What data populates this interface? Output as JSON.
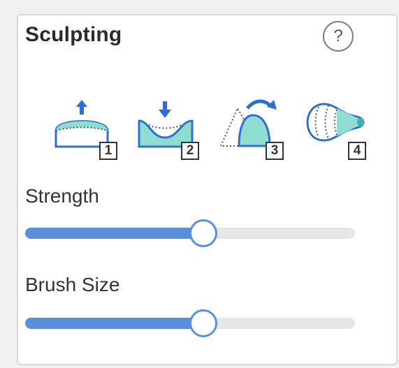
{
  "panel": {
    "title": "Sculpting",
    "help_label": "?"
  },
  "tools": [
    {
      "name": "raise",
      "key": "1",
      "icon": "raise-brush-icon"
    },
    {
      "name": "lower",
      "key": "2",
      "icon": "lower-brush-icon"
    },
    {
      "name": "smooth",
      "key": "3",
      "icon": "smooth-brush-icon"
    },
    {
      "name": "inflate",
      "key": "4",
      "icon": "inflate-brush-icon"
    }
  ],
  "strength": {
    "label": "Strength",
    "value_fraction": 0.54
  },
  "brush_size": {
    "label": "Brush Size",
    "value_fraction": 0.54
  },
  "colors": {
    "accent": "#5b8fdb",
    "icon_blue": "#2f6fd1",
    "icon_fill": "#8fdcd0"
  }
}
